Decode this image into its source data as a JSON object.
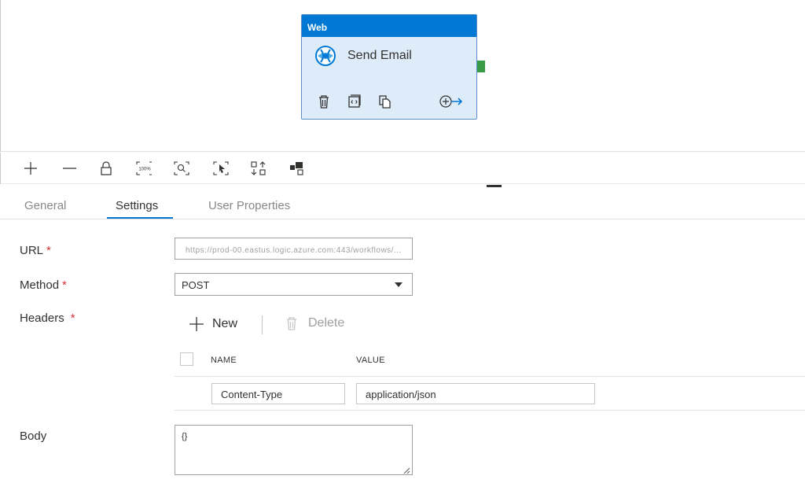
{
  "activity": {
    "type_label": "Web",
    "name": "Send Email",
    "icons": [
      "web-globe-icon",
      "delete-icon",
      "code-icon",
      "copy-icon",
      "add-output-icon"
    ]
  },
  "toolbar": {
    "icons": [
      "zoom-in-icon",
      "zoom-out-icon",
      "lock-icon",
      "zoom-100-icon",
      "zoom-to-fit-icon",
      "select-icon",
      "auto-align-icon",
      "layout-icon"
    ],
    "zoom_100_label": "100%"
  },
  "tabs": [
    {
      "label": "General"
    },
    {
      "label": "Settings",
      "active": true
    },
    {
      "label": "User Properties"
    }
  ],
  "form": {
    "url": {
      "label": "URL",
      "required": "*",
      "value": "https://prod-00.eastus.logic.azure.com:443/workflows/..."
    },
    "method": {
      "label": "Method",
      "required": "*",
      "value": "POST"
    },
    "headers": {
      "label": "Headers",
      "required": "*",
      "new_label": "New",
      "delete_label": "Delete",
      "columns": [
        "NAME",
        "VALUE"
      ],
      "rows": [
        {
          "name": "Content-Type",
          "value": "application/json"
        }
      ]
    },
    "body": {
      "label": "Body",
      "value": "{}"
    }
  },
  "colors": {
    "accent": "#0078d4",
    "activity_bg": "#deecf9",
    "handle": "#3a9b46",
    "required": "#d13438"
  }
}
